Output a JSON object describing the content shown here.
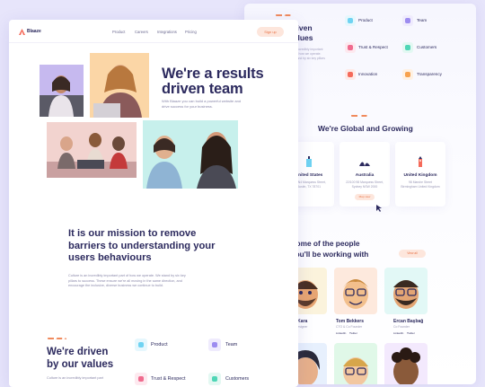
{
  "nav": {
    "brand": "Blaaze",
    "links": [
      "Product",
      "Careers",
      "Integrations",
      "Pricing"
    ],
    "signup": "Sign up"
  },
  "hero": {
    "title_line1": "We're a results",
    "title_line2": "driven team",
    "intro": "With Blaaze you can build a powerful website and drive success for your business."
  },
  "mission": {
    "title": "It is our mission to remove barriers to understanding your users behaviours",
    "body": "Culture is an incredibly important part of how we operate. We stand by six key pillars to success. These ensure we're all moving in the same direction, and encourage the inclusive, diverse business we continue to build."
  },
  "values": {
    "title_line1": "We're driven",
    "title_line2": "by our values",
    "body": "Culture is an incredibly important part",
    "items": [
      {
        "label": "Product",
        "color": "#6fd3f2"
      },
      {
        "label": "Team",
        "color": "#9d8cf0"
      },
      {
        "label": "Trust & Respect",
        "color": "#f06b8e"
      },
      {
        "label": "Customers",
        "color": "#4fd6b6"
      },
      {
        "label": "Innovation",
        "color": "#f56a5a"
      },
      {
        "label": "Transparency",
        "color": "#f7a24e"
      }
    ]
  },
  "back_values": {
    "title_line1": "driven",
    "title_line2": "values",
    "body": "is an incredibly important part of how we operate. We stand by six key pillars"
  },
  "global": {
    "title": "We're Global and Growing",
    "locations": [
      {
        "name": "United States",
        "address": "300 N4 Marquess Street, Austin, TX 78701"
      },
      {
        "name": "Australia",
        "address": "22/100 98 Marquess Street, Sydney NSW 2000",
        "button": "Map view"
      },
      {
        "name": "United Kingdom",
        "address": "98 Marshe Street Birmingham United Kingdom"
      }
    ]
  },
  "people": {
    "title_line1": "Some of the people",
    "title_line2": "you'll be working with",
    "button": "View all",
    "members": [
      {
        "name": "Filiz Kara",
        "role": "Chief Designer"
      },
      {
        "name": "Tom Bekkers",
        "role": "CTO & Co Founder",
        "social": [
          "LinkedIn",
          "Twitter"
        ]
      },
      {
        "name": "Ercan Başbağ",
        "role": "Co Founder",
        "social": [
          "LinkedIn",
          "Twitter"
        ]
      }
    ]
  }
}
